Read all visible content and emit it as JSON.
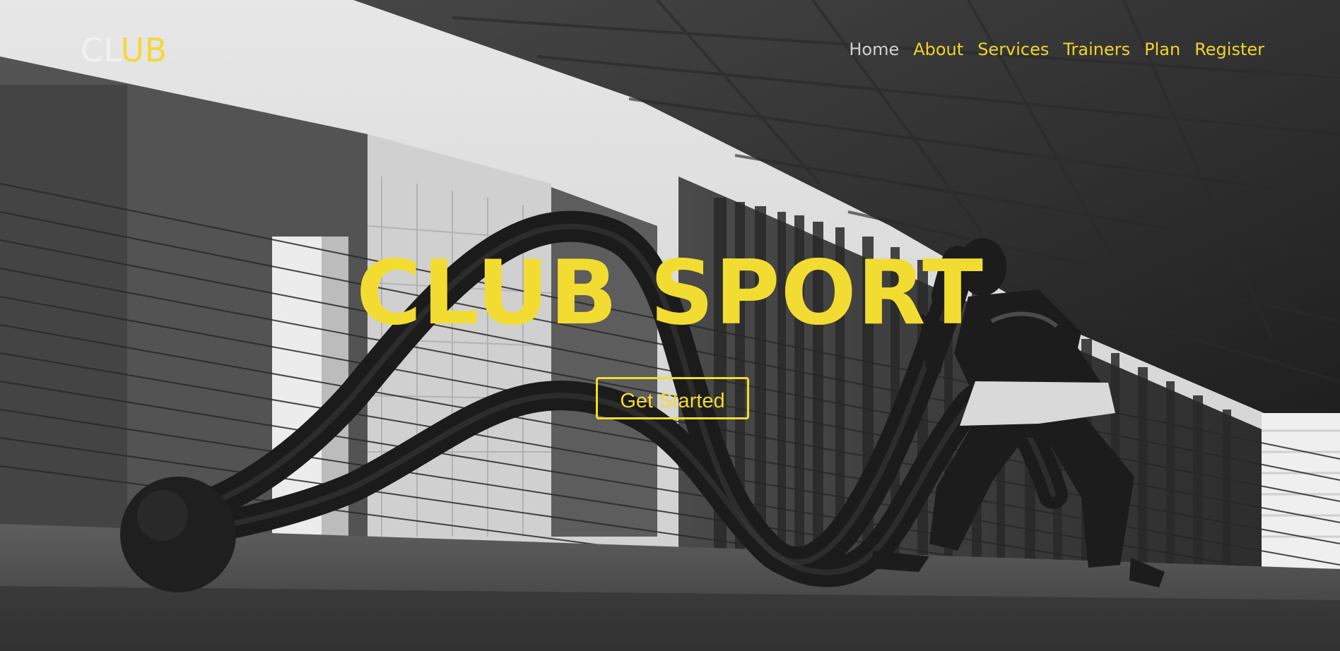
{
  "brand": {
    "part1": "CL",
    "part2": "UB",
    "primary_color": "#f4d73c",
    "secondary_color": "#f1f1f1"
  },
  "navigation": {
    "items": [
      {
        "label": "Home",
        "active": true
      },
      {
        "label": "About",
        "active": false
      },
      {
        "label": "Services",
        "active": false
      },
      {
        "label": "Trainers",
        "active": false
      },
      {
        "label": "Plan",
        "active": false
      },
      {
        "label": "Register",
        "active": false
      }
    ],
    "active_color": "#d0d0d0",
    "link_color": "#f0d32b"
  },
  "hero": {
    "title": "CLUB SPORT",
    "button_label": "Get Started",
    "accent_color": "#f3dc31",
    "background_description_icon": "gym-battle-rope-photo"
  }
}
